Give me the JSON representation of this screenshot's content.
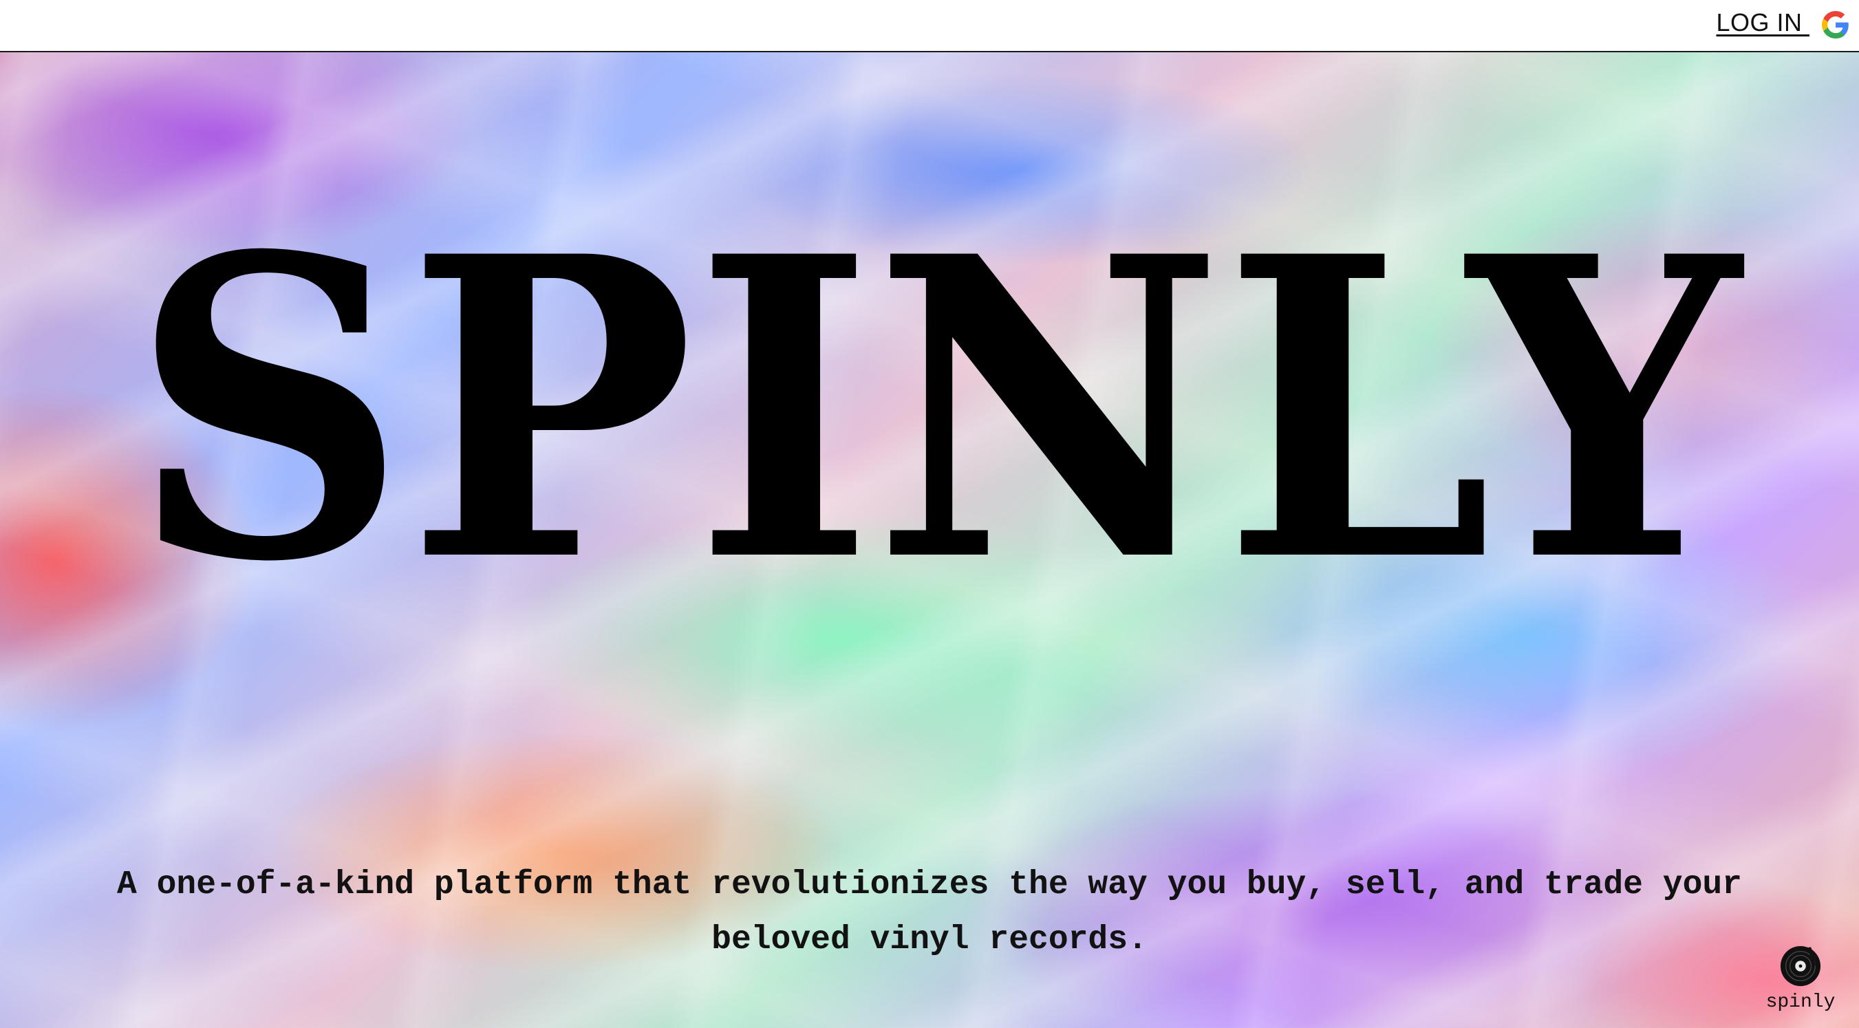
{
  "header": {
    "login_label": "LOG IN ",
    "login_provider_icon": "google-icon"
  },
  "hero": {
    "title": "SPINLY",
    "tagline_line1": "A one-of-a-kind platform that revolutionizes the way you buy, sell, and trade your",
    "tagline_line2": "beloved vinyl records."
  },
  "footer": {
    "logo_icon": "vinyl-record-icon",
    "logo_label": "spinly"
  },
  "colors": {
    "text": "#000000",
    "header_bg": "#ffffff",
    "google_blue": "#4285F4",
    "google_red": "#EA4335",
    "google_yellow": "#FBBC05",
    "google_green": "#34A853"
  }
}
